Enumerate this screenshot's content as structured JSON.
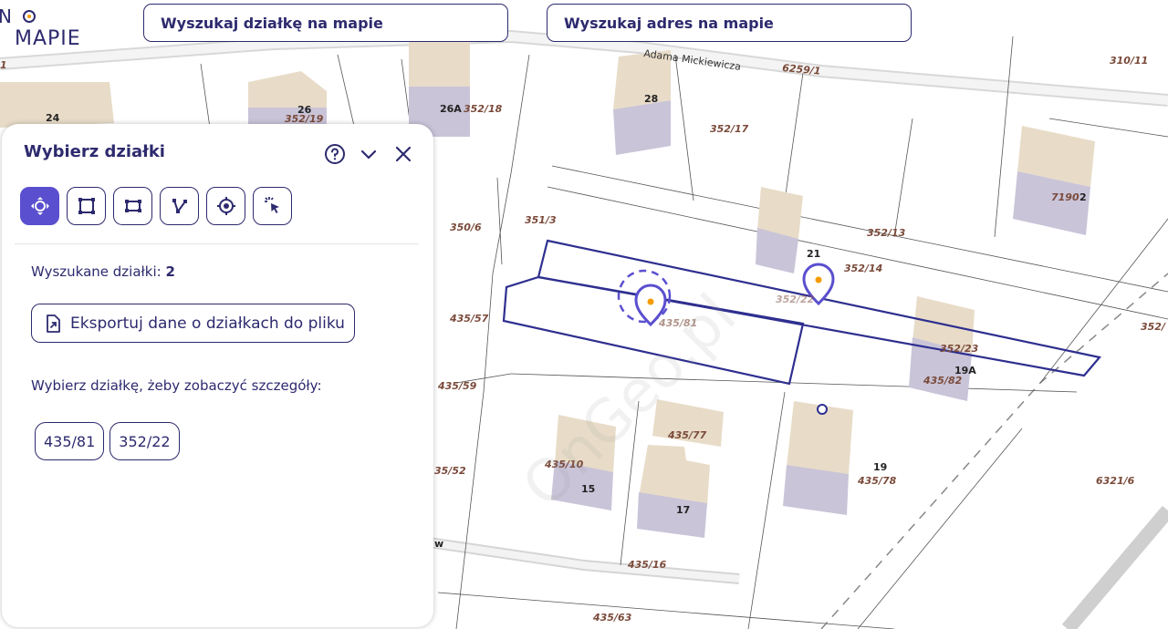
{
  "logo": {
    "line1": "N",
    "line2": "MAPIE"
  },
  "search": {
    "plot_placeholder": "Wyszukaj działkę na mapie",
    "address_placeholder": "Wyszukaj adres na mapie"
  },
  "panel": {
    "title": "Wybierz działki",
    "tools": [
      {
        "icon": "move-selection-icon",
        "active": true
      },
      {
        "icon": "rectangle-select-icon",
        "active": false
      },
      {
        "icon": "box-select-icon",
        "active": false
      },
      {
        "icon": "polygon-select-icon",
        "active": false
      },
      {
        "icon": "point-select-icon",
        "active": false
      },
      {
        "icon": "click-select-icon",
        "active": false
      }
    ],
    "found_label": "Wyszukane działki: ",
    "found_count": "2",
    "export_label": "Eksportuj dane o działkach do pliku",
    "choose_label": "Wybierz działkę, żeby zobaczyć szczegóły:",
    "plots": [
      "435/81",
      "352/22"
    ]
  },
  "map": {
    "street": "Adama Mickiewicza",
    "labels": [
      "6259/1",
      "310/11",
      "24",
      "26",
      "352/19",
      "26A",
      "352/18",
      "28",
      "352/17",
      "7190",
      "2",
      "350/6",
      "351/3",
      "352/13",
      "21",
      "352/14",
      "352/22",
      "435/57",
      "435/81",
      "352/23",
      "19A",
      "435/82",
      "352/",
      "435/59",
      "435/77",
      "435/10",
      "15",
      "17",
      "19",
      "435/78",
      "6321/6",
      "35/52",
      "435/16",
      "435/63",
      "w",
      "1"
    ],
    "watermark": "OnGeo.pl",
    "accent": "#2d2a6e",
    "selection_color": "#2e2f8f",
    "pin_accent": "#f59b00"
  }
}
